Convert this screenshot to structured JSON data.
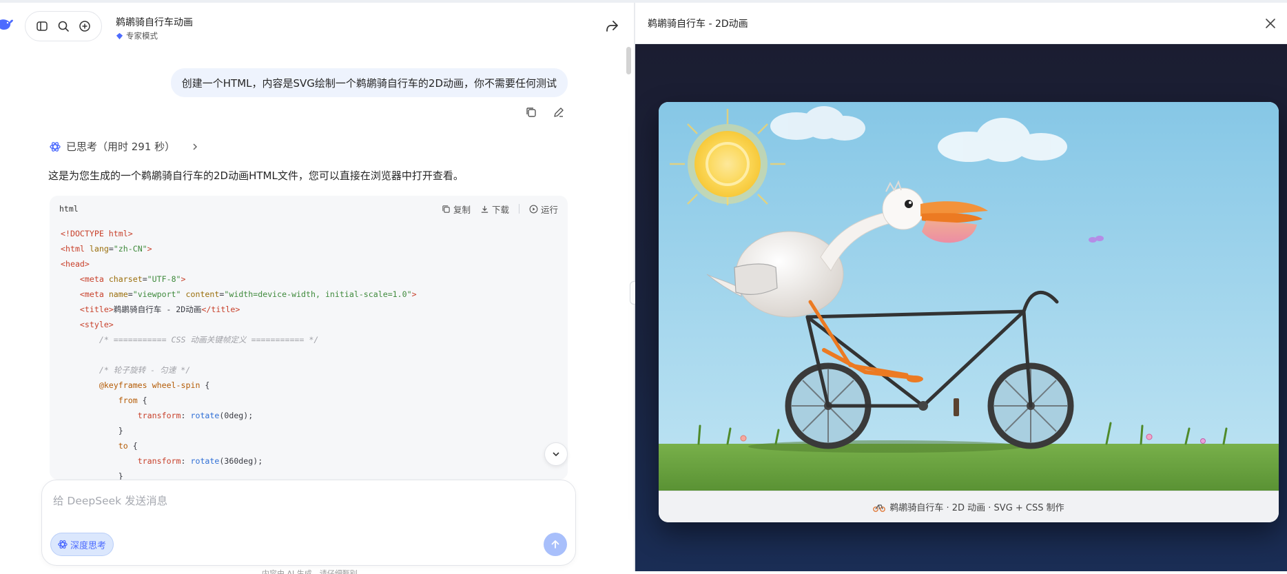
{
  "app": {
    "brand_color": "#4d6bfe"
  },
  "header": {
    "conversation_title": "鹈鹕骑自行车动画",
    "mode_label": "专家模式"
  },
  "messages": {
    "user_prompt": "创建一个HTML，内容是SVG绘制一个鹈鹕骑自行车的2D动画，你不需要任何测试",
    "thought_label": "已思考（用时 291 秒）",
    "assistant_reply": "这是为您生成的一个鹈鹕骑自行车的2D动画HTML文件，您可以直接在浏览器中打开查看。"
  },
  "code_block": {
    "language": "html",
    "copy_label": "复制",
    "download_label": "下载",
    "run_label": "运行"
  },
  "composer": {
    "placeholder": "给 DeepSeek 发送消息",
    "deep_think_label": "深度思考",
    "disclaimer": "内容由 AI 生成，请仔细甄别"
  },
  "preview": {
    "title": "鹈鹕骑自行车 - 2D动画",
    "caption": "鹈鹕骑自行车 · 2D 动画 · SVG + CSS 制作"
  },
  "icons": [
    "deepseek-logo",
    "sidebar-toggle-icon",
    "search-icon",
    "new-chat-icon",
    "share-icon",
    "copy-icon",
    "edit-icon",
    "thought-icon",
    "chevron-right-icon",
    "download-icon",
    "run-icon",
    "chevron-down-icon",
    "send-arrow-icon",
    "close-icon",
    "bicycle-icon"
  ]
}
